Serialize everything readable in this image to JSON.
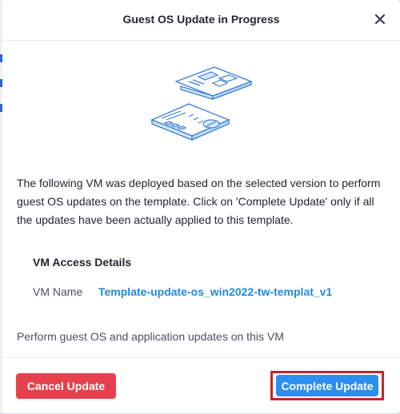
{
  "dialog": {
    "title": "Guest OS Update in Progress",
    "close_icon": "close-icon"
  },
  "illustration": {
    "icon": "documents-illustration-icon"
  },
  "body": {
    "description": "The following VM was deployed based on the selected version to perform guest OS updates on the template. Click on 'Complete Update' only if all the updates have been actually applied to this template.",
    "access_details": {
      "title": "VM Access Details",
      "vm_name_label": "VM Name",
      "vm_name_value": "Template-update-os_win2022-tw-templat_v1"
    },
    "perform_text": "Perform guest OS and application updates on this VM"
  },
  "footer": {
    "cancel_label": "Cancel Update",
    "complete_label": "Complete Update"
  },
  "colors": {
    "accent": "#2b8ef0",
    "danger": "#e5414d",
    "link": "#1f8ae0",
    "highlight_outline": "#c0272d"
  }
}
